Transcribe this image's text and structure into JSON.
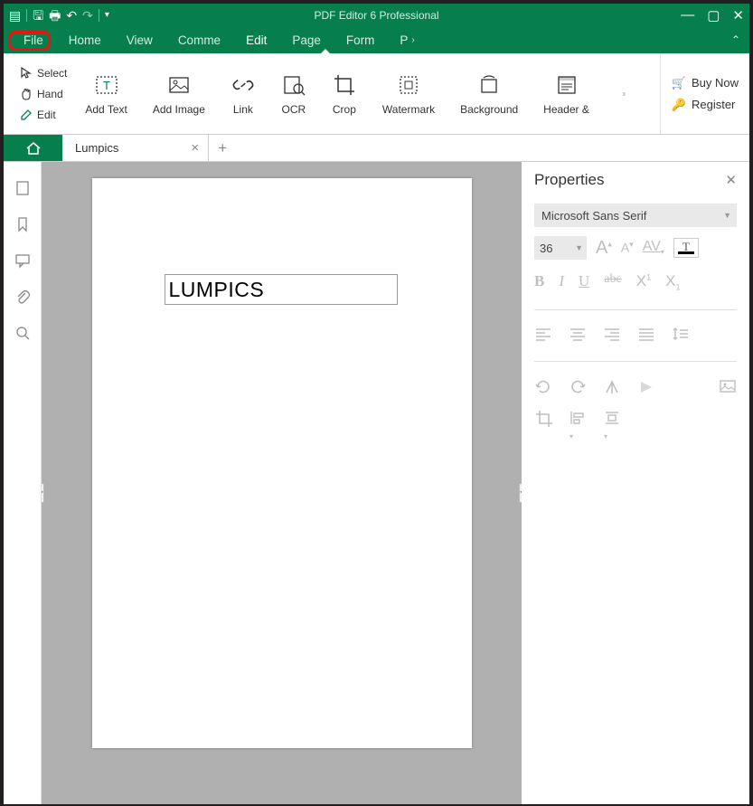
{
  "app": {
    "title": "PDF Editor 6 Professional"
  },
  "menu": {
    "file": "File",
    "home": "Home",
    "view": "View",
    "comment": "Comme",
    "edit": "Edit",
    "page": "Page",
    "form": "Form",
    "protect": "P"
  },
  "leftTools": {
    "select": "Select",
    "hand": "Hand",
    "edit": "Edit"
  },
  "ribbon": {
    "addText": "Add Text",
    "addImage": "Add Image",
    "link": "Link",
    "ocr": "OCR",
    "crop": "Crop",
    "watermark": "Watermark",
    "background": "Background",
    "header": "Header &"
  },
  "promo": {
    "buy": "Buy Now",
    "register": "Register"
  },
  "tabs": {
    "doc1": "Lumpics"
  },
  "document": {
    "text1": "LUMPICS"
  },
  "properties": {
    "title": "Properties",
    "font": "Microsoft Sans Serif",
    "size": "36",
    "grow": "A",
    "shrink": "A",
    "kern": "AV",
    "color": "T",
    "bold": "B",
    "italic": "I",
    "underline": "U",
    "strike": "abc",
    "super": "X",
    "sub": "X"
  }
}
